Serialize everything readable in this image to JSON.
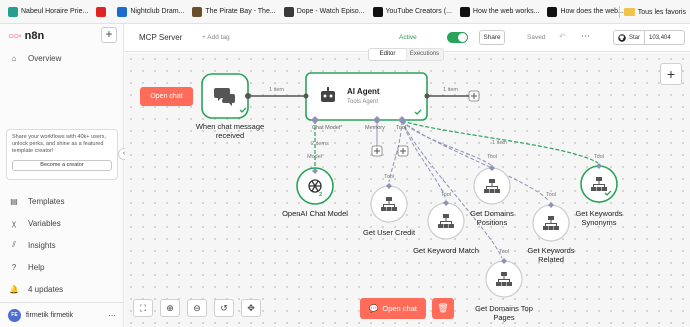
{
  "bookmarks": [
    {
      "label": "Nabeul Horaire Prie...",
      "color": "#2a9d8f"
    },
    {
      "label": "",
      "color": "#e02424"
    },
    {
      "label": "Nightclub Dram...",
      "color": "#1c6bd1"
    },
    {
      "label": "The Pirate Bay - The...",
      "color": "#6b4f2a"
    },
    {
      "label": "Dope - Watch Episo...",
      "color": "#3a3a3a"
    },
    {
      "label": "YouTube Creators (...",
      "color": "#111111"
    },
    {
      "label": "How the web works...",
      "color": "#111111"
    },
    {
      "label": "How does the web...",
      "color": "#111111"
    }
  ],
  "bookmarks_all": "Tous les favoris",
  "sidebar": {
    "brand": "n8n",
    "add": "+",
    "overview": "Overview",
    "promo_text": "Share your workflows with 40k+ users, unlock perks, and shine as a featured template creator!",
    "promo_button": "Become a creator",
    "collapse": "‹",
    "items": [
      {
        "label": "Templates",
        "icon": "▤"
      },
      {
        "label": "Variables",
        "icon": "χ"
      },
      {
        "label": "Insights",
        "icon": "⫽"
      },
      {
        "label": "Help",
        "icon": "?"
      },
      {
        "label": "4 updates",
        "icon": "🔔"
      }
    ],
    "user_initials": "FE",
    "user_name": "firmetik firmetik",
    "user_more": "⋯"
  },
  "header": {
    "workflow_name": "MCP Server",
    "add_tag": "+ Add tag",
    "active_label": "Active",
    "share": "Share",
    "saved": "Saved",
    "github_star": "Star",
    "github_count": "103,404"
  },
  "tabs": {
    "editor": "Editor",
    "executions": "Executions"
  },
  "canvas": {
    "open_chat_chip": "Open chat",
    "trigger_label_line1": "When chat message",
    "trigger_label_line2": "received",
    "agent_title": "AI Agent",
    "agent_subtitle": "Tools Agent",
    "edge_in": "1 item",
    "edge_out": "1 item",
    "port_chat_model": "Chat Model*",
    "port_memory": "Memory",
    "port_tool": "Tool",
    "model_items": "2 items",
    "model_tag": "Model",
    "model_count": "2",
    "tool_tag": "Tool",
    "synonyms_items": "1 item",
    "nodes": {
      "openai": "OpenAI Chat Model",
      "user_credit": "Get User Credit",
      "keyword_match": "Get Keyword Match",
      "domains_positions_1": "Get Domains",
      "domains_positions_2": "Positions",
      "keywords_related_1": "Get Keywords",
      "keywords_related_2": "Related",
      "keywords_synonyms_1": "Get Keywords",
      "keywords_synonyms_2": "Synonyms",
      "domains_top_1": "Get Domains Top",
      "domains_top_2": "Pages"
    },
    "plus": "+"
  },
  "controls": {
    "fit": "⛶",
    "zoom_in": "⊕",
    "zoom_out": "⊖",
    "reset": "↺",
    "tidy": "✥",
    "open_chat": "Open chat",
    "delete": "🗑"
  },
  "colors": {
    "accent": "#ff6d5a",
    "success": "#29a35a",
    "tool_edge": "#8d93b8",
    "brand": "#ea4b71"
  }
}
